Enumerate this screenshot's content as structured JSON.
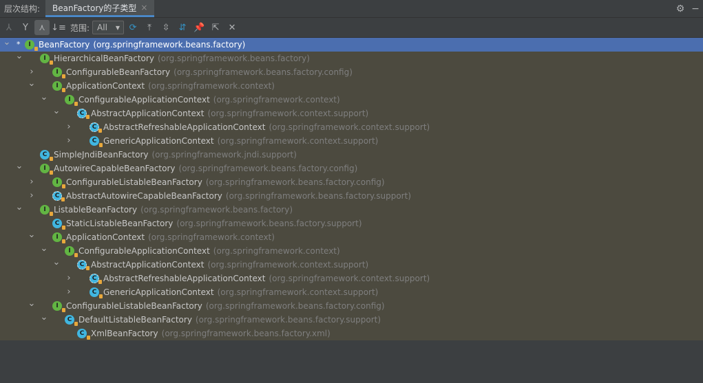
{
  "titlebar": {
    "label": "层次结构:",
    "tab_label": "BeanFactory的子类型",
    "tab_close": "×"
  },
  "toolbar": {
    "scope_label": "范围:",
    "scope_value": "All"
  },
  "tree": [
    {
      "depth": 0,
      "toggle": "open",
      "kind": "i",
      "name": "BeanFactory",
      "pkg": "(org.springframework.beans.factory)",
      "selected": true,
      "star": true
    },
    {
      "depth": 1,
      "toggle": "open",
      "kind": "i",
      "name": "HierarchicalBeanFactory",
      "pkg": "(org.springframework.beans.factory)"
    },
    {
      "depth": 2,
      "toggle": "closed",
      "kind": "i",
      "name": "ConfigurableBeanFactory",
      "pkg": "(org.springframework.beans.factory.config)"
    },
    {
      "depth": 2,
      "toggle": "open",
      "kind": "i",
      "name": "ApplicationContext",
      "pkg": "(org.springframework.context)"
    },
    {
      "depth": 3,
      "toggle": "open",
      "kind": "i",
      "name": "ConfigurableApplicationContext",
      "pkg": "(org.springframework.context)"
    },
    {
      "depth": 4,
      "toggle": "open",
      "kind": "ac",
      "name": "AbstractApplicationContext",
      "pkg": "(org.springframework.context.support)"
    },
    {
      "depth": 5,
      "toggle": "closed",
      "kind": "ac",
      "name": "AbstractRefreshableApplicationContext",
      "pkg": "(org.springframework.context.support)"
    },
    {
      "depth": 5,
      "toggle": "closed",
      "kind": "c",
      "name": "GenericApplicationContext",
      "pkg": "(org.springframework.context.support)"
    },
    {
      "depth": 1,
      "toggle": "none",
      "kind": "c",
      "name": "SimpleJndiBeanFactory",
      "pkg": "(org.springframework.jndi.support)"
    },
    {
      "depth": 1,
      "toggle": "open",
      "kind": "i",
      "name": "AutowireCapableBeanFactory",
      "pkg": "(org.springframework.beans.factory.config)"
    },
    {
      "depth": 2,
      "toggle": "closed",
      "kind": "i",
      "name": "ConfigurableListableBeanFactory",
      "pkg": "(org.springframework.beans.factory.config)"
    },
    {
      "depth": 2,
      "toggle": "closed",
      "kind": "ac",
      "name": "AbstractAutowireCapableBeanFactory",
      "pkg": "(org.springframework.beans.factory.support)"
    },
    {
      "depth": 1,
      "toggle": "open",
      "kind": "i",
      "name": "ListableBeanFactory",
      "pkg": "(org.springframework.beans.factory)"
    },
    {
      "depth": 2,
      "toggle": "none",
      "kind": "c",
      "name": "StaticListableBeanFactory",
      "pkg": "(org.springframework.beans.factory.support)"
    },
    {
      "depth": 2,
      "toggle": "open",
      "kind": "i",
      "name": "ApplicationContext",
      "pkg": "(org.springframework.context)"
    },
    {
      "depth": 3,
      "toggle": "open",
      "kind": "i",
      "name": "ConfigurableApplicationContext",
      "pkg": "(org.springframework.context)"
    },
    {
      "depth": 4,
      "toggle": "open",
      "kind": "ac",
      "name": "AbstractApplicationContext",
      "pkg": "(org.springframework.context.support)"
    },
    {
      "depth": 5,
      "toggle": "closed",
      "kind": "ac",
      "name": "AbstractRefreshableApplicationContext",
      "pkg": "(org.springframework.context.support)"
    },
    {
      "depth": 5,
      "toggle": "closed",
      "kind": "c",
      "name": "GenericApplicationContext",
      "pkg": "(org.springframework.context.support)"
    },
    {
      "depth": 2,
      "toggle": "open",
      "kind": "i",
      "name": "ConfigurableListableBeanFactory",
      "pkg": "(org.springframework.beans.factory.config)"
    },
    {
      "depth": 3,
      "toggle": "open",
      "kind": "c",
      "name": "DefaultListableBeanFactory",
      "pkg": "(org.springframework.beans.factory.support)"
    },
    {
      "depth": 4,
      "toggle": "none",
      "kind": "c",
      "name": "XmlBeanFactory",
      "pkg": "(org.springframework.beans.factory.xml)"
    }
  ]
}
